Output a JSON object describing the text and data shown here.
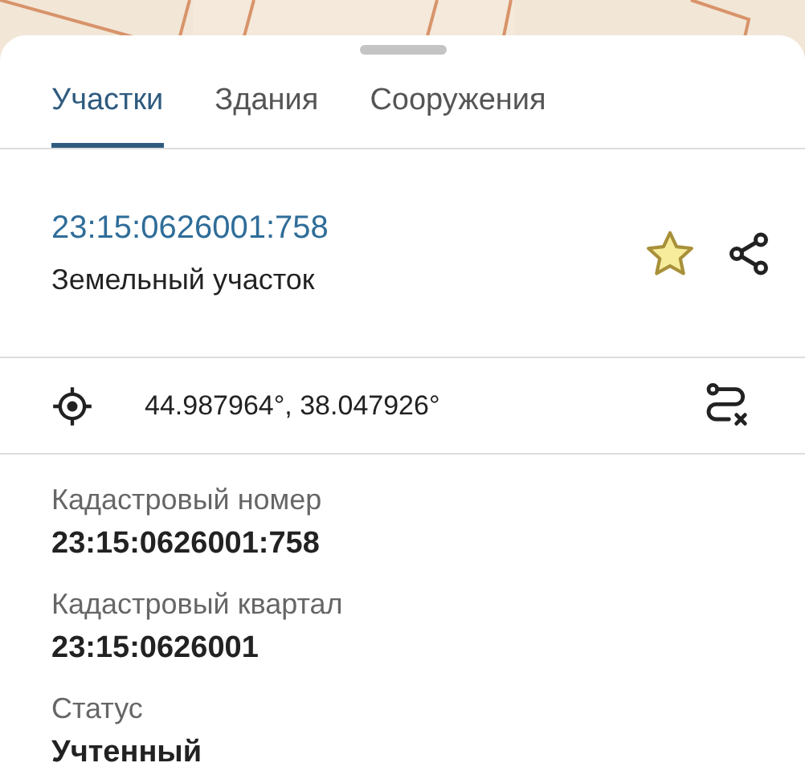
{
  "tabs": [
    {
      "label": "Участки",
      "selected": true
    },
    {
      "label": "Здания",
      "selected": false
    },
    {
      "label": "Сооружения",
      "selected": false
    }
  ],
  "parcel": {
    "number": "23:15:0626001:758",
    "type": "Земельный участок"
  },
  "coordinates": "44.987964°, 38.047926°",
  "fields": [
    {
      "label": "Кадастровый номер",
      "value": "23:15:0626001:758"
    },
    {
      "label": "Кадастровый квартал",
      "value": "23:15:0626001"
    },
    {
      "label": "Статус",
      "value": "Учтенный"
    }
  ]
}
